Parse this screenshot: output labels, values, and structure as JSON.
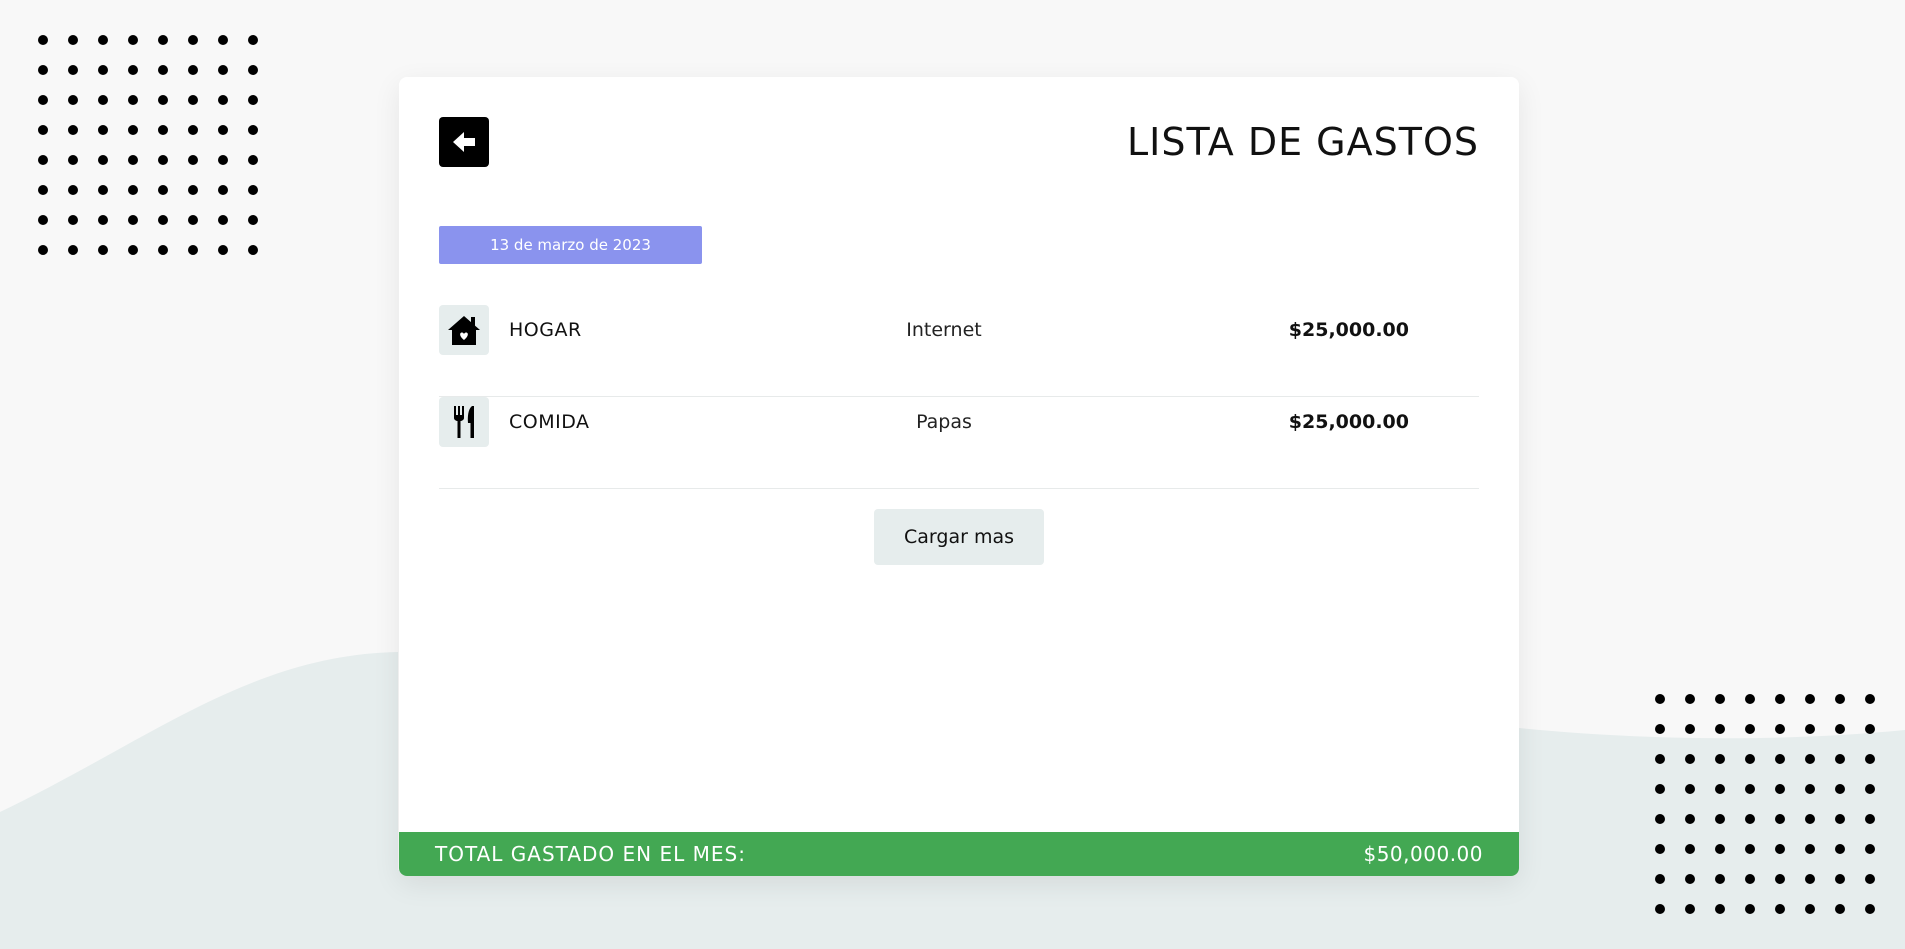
{
  "header": {
    "title": "LISTA DE GASTOS",
    "back_icon": "arrow-left-icon"
  },
  "date_group": {
    "label": "13 de marzo de 2023",
    "color": "#8a93ee"
  },
  "expenses": [
    {
      "category": "HOGAR",
      "icon": "house-heart-icon",
      "description": "Internet",
      "amount": "$25,000.00"
    },
    {
      "category": "COMIDA",
      "icon": "fork-knife-icon",
      "description": "Papas",
      "amount": "$25,000.00"
    }
  ],
  "load_more": {
    "label": "Cargar mas"
  },
  "footer": {
    "label": "TOTAL GASTADO EN EL MES:",
    "value": "$50,000.00",
    "color": "#43a853"
  }
}
